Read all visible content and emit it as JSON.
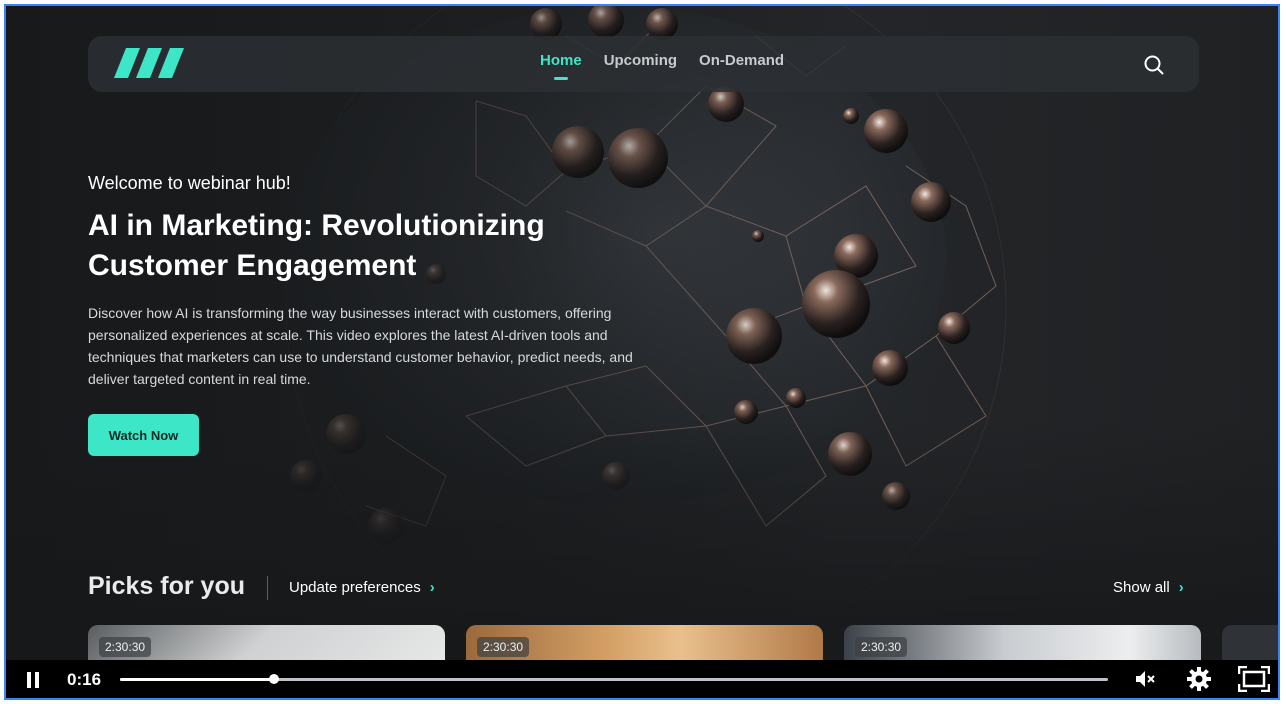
{
  "nav": {
    "links": [
      {
        "label": "Home",
        "active": true
      },
      {
        "label": "Upcoming",
        "active": false
      },
      {
        "label": "On-Demand",
        "active": false
      }
    ],
    "search_icon": "search-icon",
    "logo_icon": "slashes-logo"
  },
  "hero": {
    "subtitle": "Welcome to webinar hub!",
    "title": "AI in Marketing: Revolutionizing Customer Engagement",
    "description": "Discover how AI is transforming the way businesses interact with customers, offering personalized experiences at scale. This video explores the latest AI-driven tools and techniques that marketers can use to understand customer behavior, predict needs, and deliver targeted content in real time.",
    "cta_label": "Watch Now"
  },
  "picks": {
    "title": "Picks for you",
    "update_label": "Update preferences",
    "show_all_label": "Show all",
    "cards": [
      {
        "duration": "2:30:30"
      },
      {
        "duration": "2:30:30"
      },
      {
        "duration": "2:30:30"
      }
    ]
  },
  "player": {
    "time": "0:16",
    "progress_fraction": 0.156,
    "icons": [
      "pause-icon",
      "mute-icon",
      "settings-icon",
      "fullscreen-icon"
    ]
  },
  "colors": {
    "accent": "#3ee6c8",
    "background": "#1e2022",
    "player_bar": "#000000"
  }
}
